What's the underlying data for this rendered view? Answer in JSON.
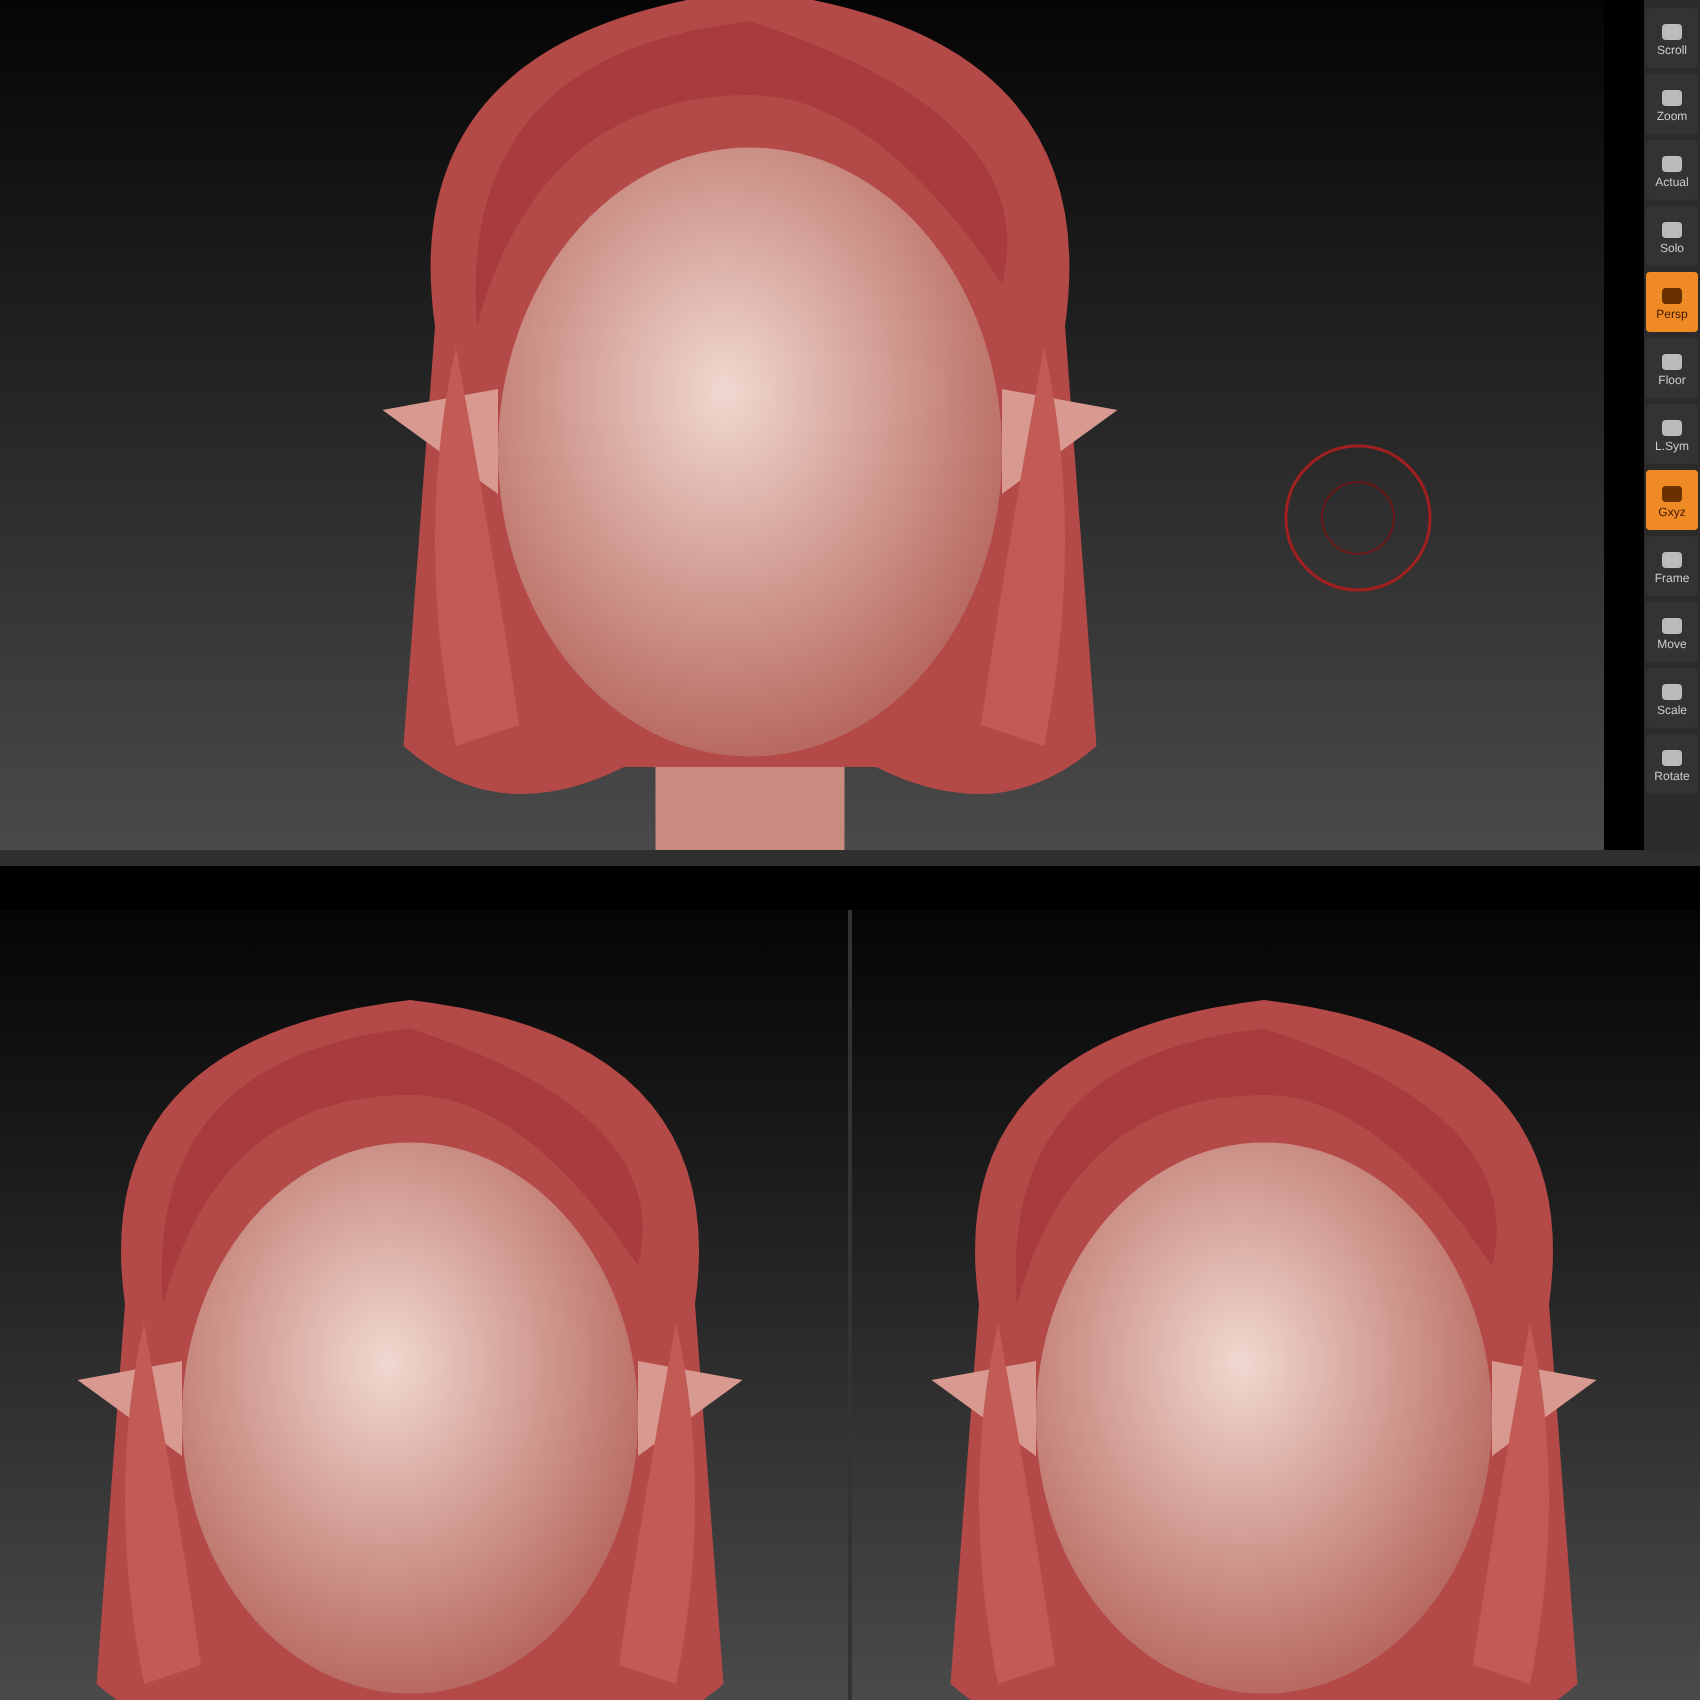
{
  "toolbar": [
    {
      "label": "Scroll",
      "selected": false
    },
    {
      "label": "Zoom",
      "selected": false
    },
    {
      "label": "Actual",
      "selected": false
    },
    {
      "label": "Solo",
      "selected": false
    },
    {
      "label": "Persp",
      "selected": true
    },
    {
      "label": "Floor",
      "selected": false
    },
    {
      "label": "L.Sym",
      "selected": false
    },
    {
      "label": "Gxyz",
      "selected": true
    },
    {
      "label": "Frame",
      "selected": false
    },
    {
      "label": "Move",
      "selected": false
    },
    {
      "label": "Scale",
      "selected": false
    },
    {
      "label": "Rotate",
      "selected": false
    }
  ]
}
